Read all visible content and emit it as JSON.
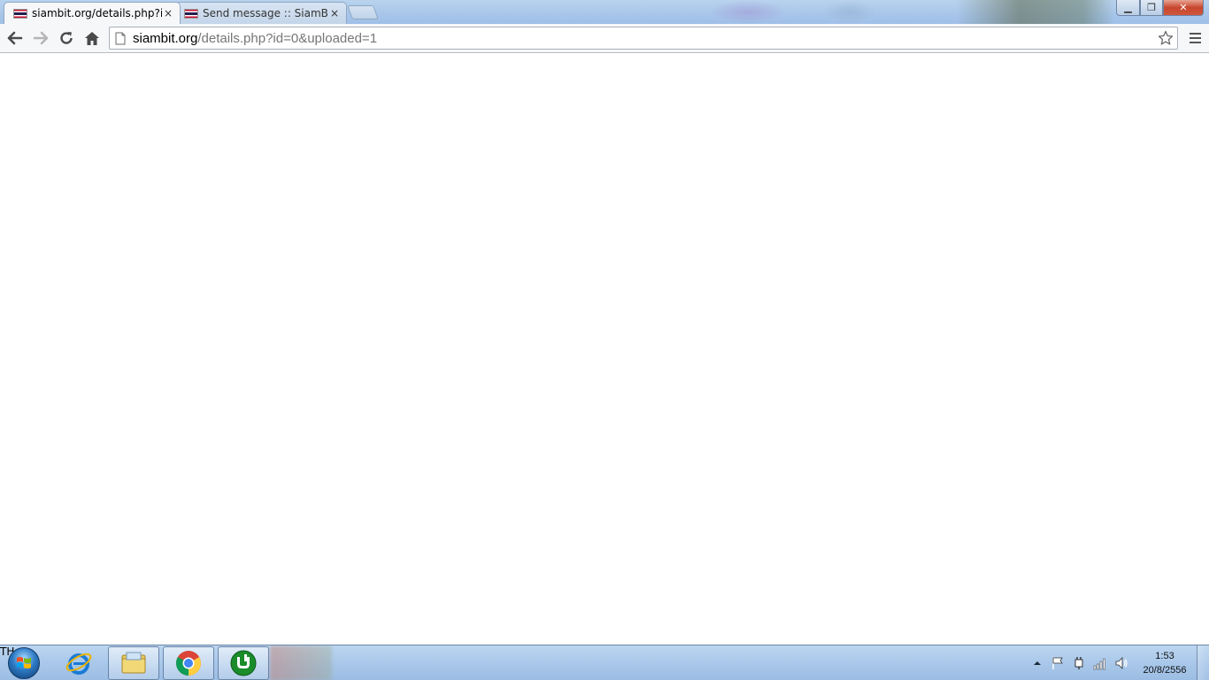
{
  "browser": {
    "tabs": [
      {
        "title": "siambit.org/details.php?id",
        "active": true
      },
      {
        "title": "Send message :: SiamBIT::",
        "active": false
      }
    ],
    "close_glyph": "×",
    "url_host": "siambit.org",
    "url_path": "/details.php?id=0&uploaded=1"
  },
  "window_controls": {
    "minimize": "▁",
    "maximize": "❐",
    "close": "✕"
  },
  "taskbar": {
    "pinned": [
      "windows-start",
      "internet-explorer-icon",
      "file-explorer-icon",
      "chrome-icon",
      "utorrent-icon"
    ],
    "tray": {
      "language": "TH",
      "time": "1:53",
      "date": "20/8/2556"
    }
  },
  "colors": {
    "tab_active_bg": "#f6f7f9",
    "titlebar": "#a8c6ea",
    "close_button": "#c7472e",
    "url_path_gray": "#767676"
  }
}
